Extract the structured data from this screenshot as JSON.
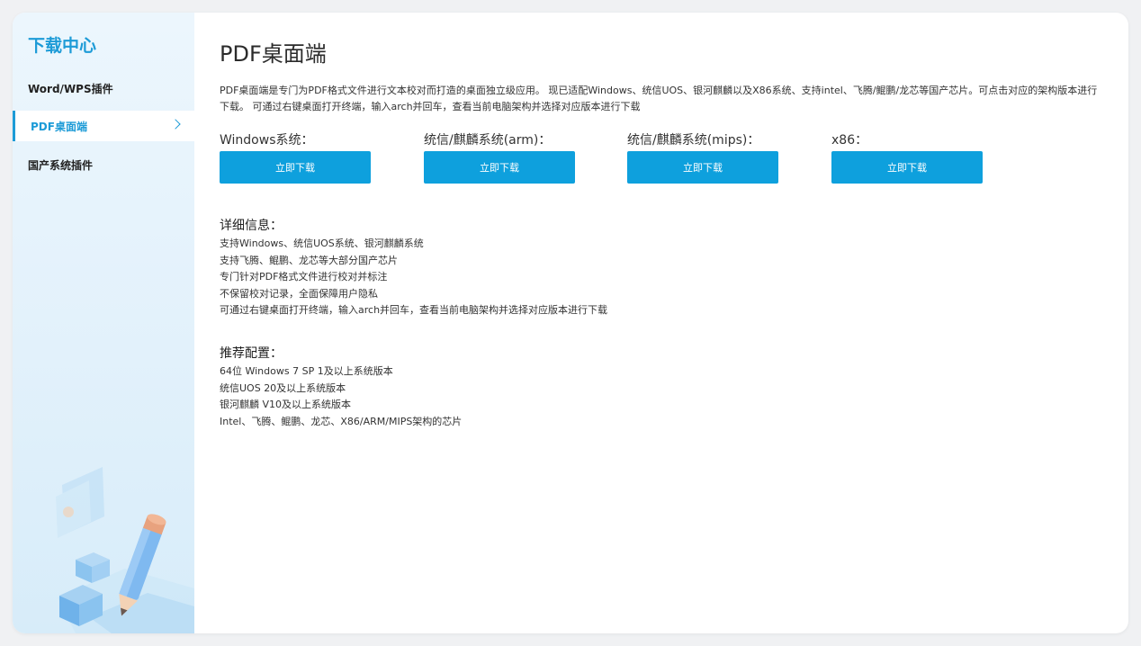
{
  "sidebar": {
    "title": "下载中心",
    "items": [
      {
        "label": "Word/WPS插件"
      },
      {
        "label": "PDF桌面端"
      },
      {
        "label": "国产系统插件"
      }
    ]
  },
  "main": {
    "title": "PDF桌面端",
    "intro": "PDF桌面端是专门为PDF格式文件进行文本校对而打造的桌面独立级应用。 现已适配Windows、统信UOS、银河麒麟以及X86系统、支持intel、飞腾/鲲鹏/龙芯等国产芯片。可点击对应的架构版本进行下载。 可通过右键桌面打开终端，输入arch并回车，查看当前电脑架构并选择对应版本进行下载",
    "downloads": [
      {
        "label": "Windows系统：",
        "button": "立即下载"
      },
      {
        "label": "统信/麒麟系统(arm)：",
        "button": "立即下载"
      },
      {
        "label": "统信/麒麟系统(mips)：",
        "button": "立即下载"
      },
      {
        "label": "x86：",
        "button": "立即下载"
      }
    ],
    "details": {
      "title": "详细信息：",
      "lines": [
        "支持Windows、统信UOS系统、银河麒麟系统",
        "支持飞腾、鲲鹏、龙芯等大部分国产芯片",
        "专门针对PDF格式文件进行校对并标注",
        "不保留校对记录，全面保障用户隐私",
        "可通过右键桌面打开终端，输入arch并回车，查看当前电脑架构并选择对应版本进行下载"
      ]
    },
    "requirements": {
      "title": "推荐配置：",
      "lines": [
        "64位 Windows 7 SP 1及以上系统版本",
        "统信UOS 20及以上系统版本",
        "银河麒麟 V10及以上系统版本",
        "Intel、飞腾、鲲鹏、龙芯、X86/ARM/MIPS架构的芯片"
      ]
    }
  },
  "colors": {
    "accent": "#1d9bd7",
    "button": "#0ea0dd"
  }
}
